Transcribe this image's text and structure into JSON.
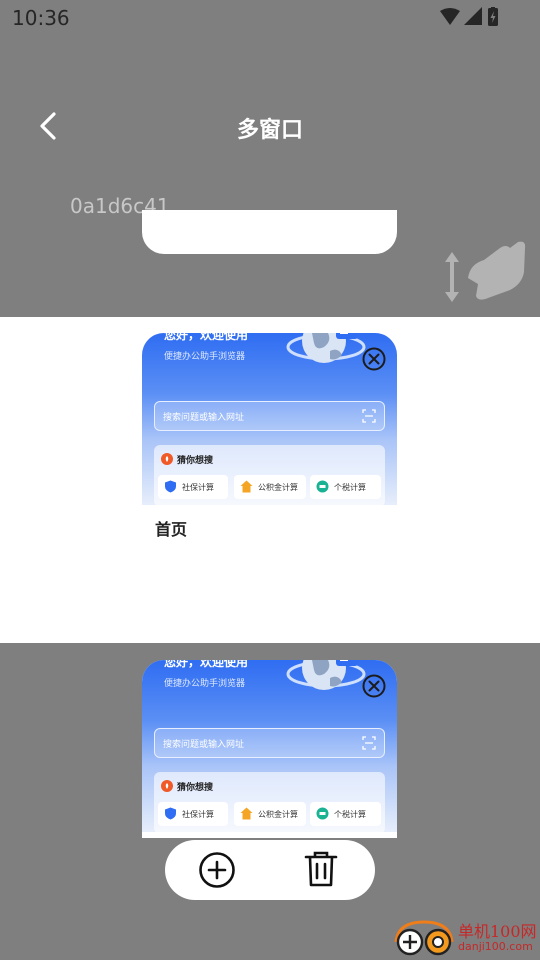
{
  "status_bar": {
    "time": "10:36"
  },
  "header": {
    "title": "多窗口",
    "back_icon": "chevron-left-icon"
  },
  "overlay_code": "0a1d6c41",
  "windows": [
    {
      "label": "首页",
      "preview": {
        "greeting": "您好，欢迎使用",
        "subtitle": "便捷办公助手浏览器",
        "search_placeholder": "搜索问题或输入网址",
        "suggest_title": "猜你想搜",
        "chips": [
          "社保计算",
          "公积金计算",
          "个税计算"
        ]
      }
    },
    {
      "label": "",
      "preview": {
        "greeting": "您好，欢迎使用",
        "subtitle": "便捷办公助手浏览器",
        "search_placeholder": "搜索问题或输入网址",
        "suggest_title": "猜你想搜",
        "chips": [
          "社保计算",
          "公积金计算",
          "个税计算"
        ]
      }
    }
  ],
  "bottom_bar": {
    "add_icon": "add-circle-icon",
    "delete_icon": "trash-icon"
  },
  "watermark": {
    "text": "单机100网",
    "url": "danji100.com"
  },
  "colors": {
    "backdrop": "#7f7f7f",
    "accent_blue": "#2f6df2",
    "white": "#ffffff"
  }
}
